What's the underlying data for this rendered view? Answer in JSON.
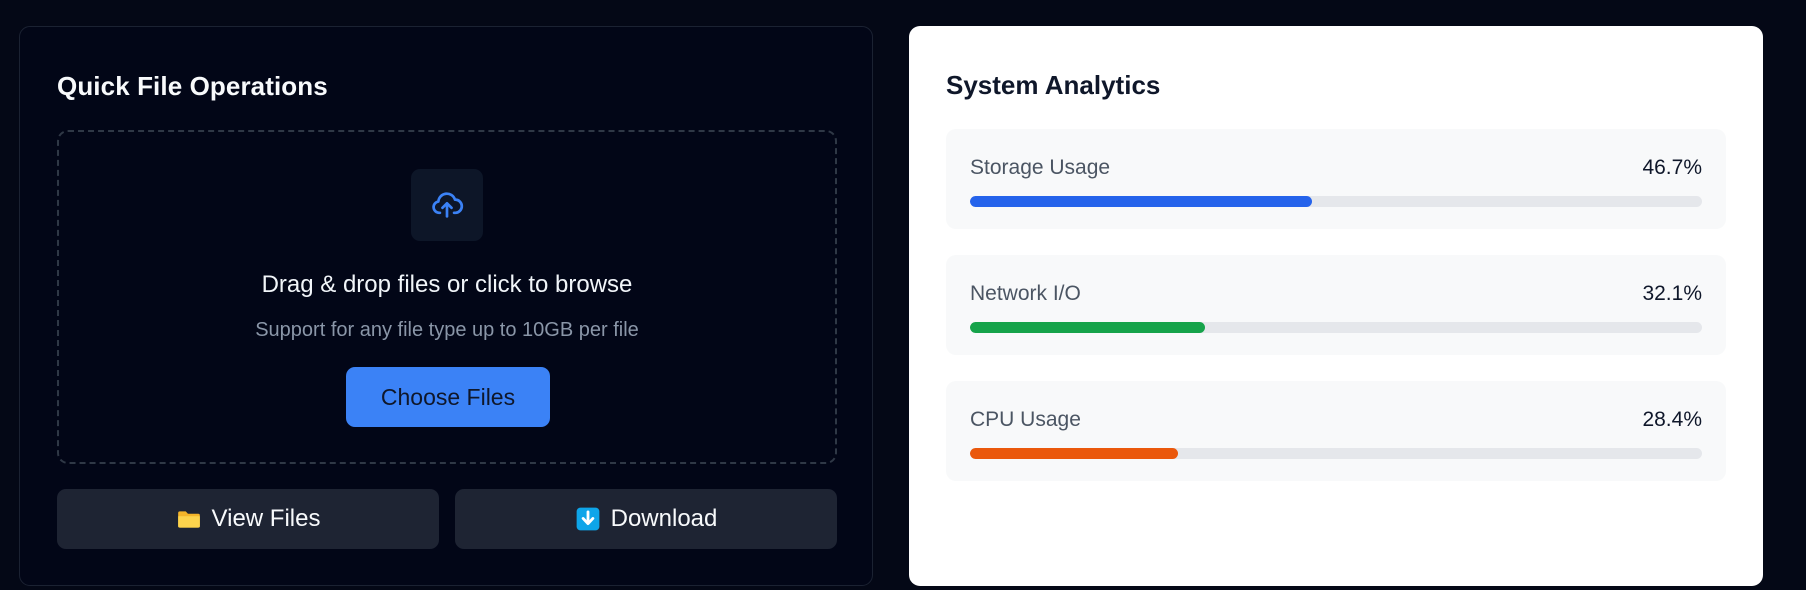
{
  "operations": {
    "title": "Quick File Operations",
    "dropzone": {
      "headline": "Drag & drop files or click to browse",
      "subtext": "Support for any file type up to 10GB per file",
      "button_label": "Choose Files",
      "icon": "cloud-upload-icon"
    },
    "actions": [
      {
        "label": "View Files",
        "icon": "folder-icon"
      },
      {
        "label": "Download",
        "icon": "download-icon"
      }
    ]
  },
  "analytics": {
    "title": "System Analytics",
    "metrics": [
      {
        "label": "Storage Usage",
        "value": "46.7%",
        "percent": 46.7,
        "color": "#2563eb"
      },
      {
        "label": "Network I/O",
        "value": "32.1%",
        "percent": 32.1,
        "color": "#16a34a"
      },
      {
        "label": "CPU Usage",
        "value": "28.4%",
        "percent": 28.4,
        "color": "#ea580c"
      }
    ]
  },
  "colors": {
    "background": "#040816",
    "accent": "#3b82f6",
    "card_dark": "#020617",
    "card_light": "#ffffff"
  }
}
